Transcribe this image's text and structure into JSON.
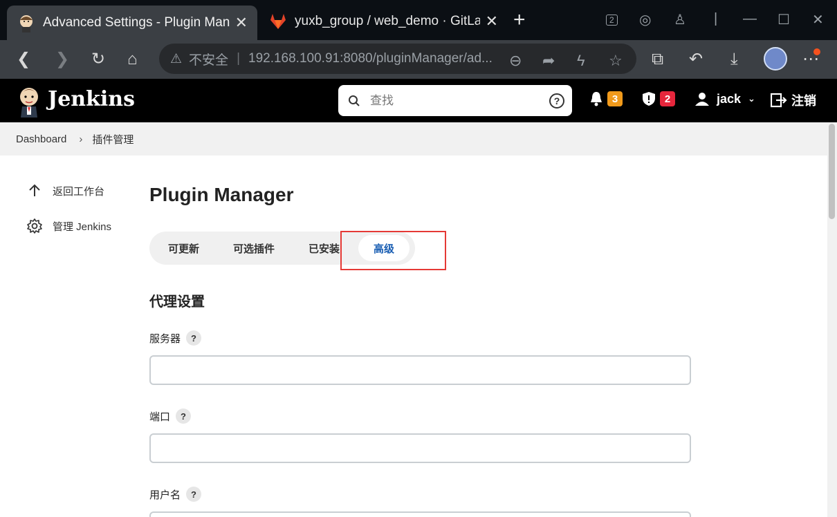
{
  "browser": {
    "tabs": [
      {
        "title": "Advanced Settings - Plugin Manager",
        "active": true
      },
      {
        "title": "yuxb_group / web_demo · GitLab",
        "active": false
      }
    ],
    "window_badge": "2",
    "omnibox": {
      "security_label": "不安全",
      "url": "192.168.100.91:8080/pluginManager/ad..."
    }
  },
  "jenkins": {
    "brand": "Jenkins",
    "search_placeholder": "查找",
    "notifications_count": "3",
    "security_count": "2",
    "user": "jack",
    "logout": "注销",
    "colors": {
      "notification_badge": "#f19a1b",
      "security_badge": "#e6263c",
      "link_blue": "#1b5fb3"
    }
  },
  "breadcrumb": [
    "Dashboard",
    "插件管理"
  ],
  "sidebar": [
    {
      "icon": "arrow-up-icon",
      "label": "返回工作台"
    },
    {
      "icon": "gear-icon",
      "label": "管理 Jenkins"
    }
  ],
  "main": {
    "title": "Plugin Manager",
    "tabs": [
      "可更新",
      "可选插件",
      "已安装",
      "高级"
    ],
    "selected_tab": "高级",
    "section_title": "代理设置",
    "fields": [
      {
        "label": "服务器",
        "value": ""
      },
      {
        "label": "端口",
        "value": ""
      },
      {
        "label": "用户名",
        "value": ""
      }
    ]
  }
}
